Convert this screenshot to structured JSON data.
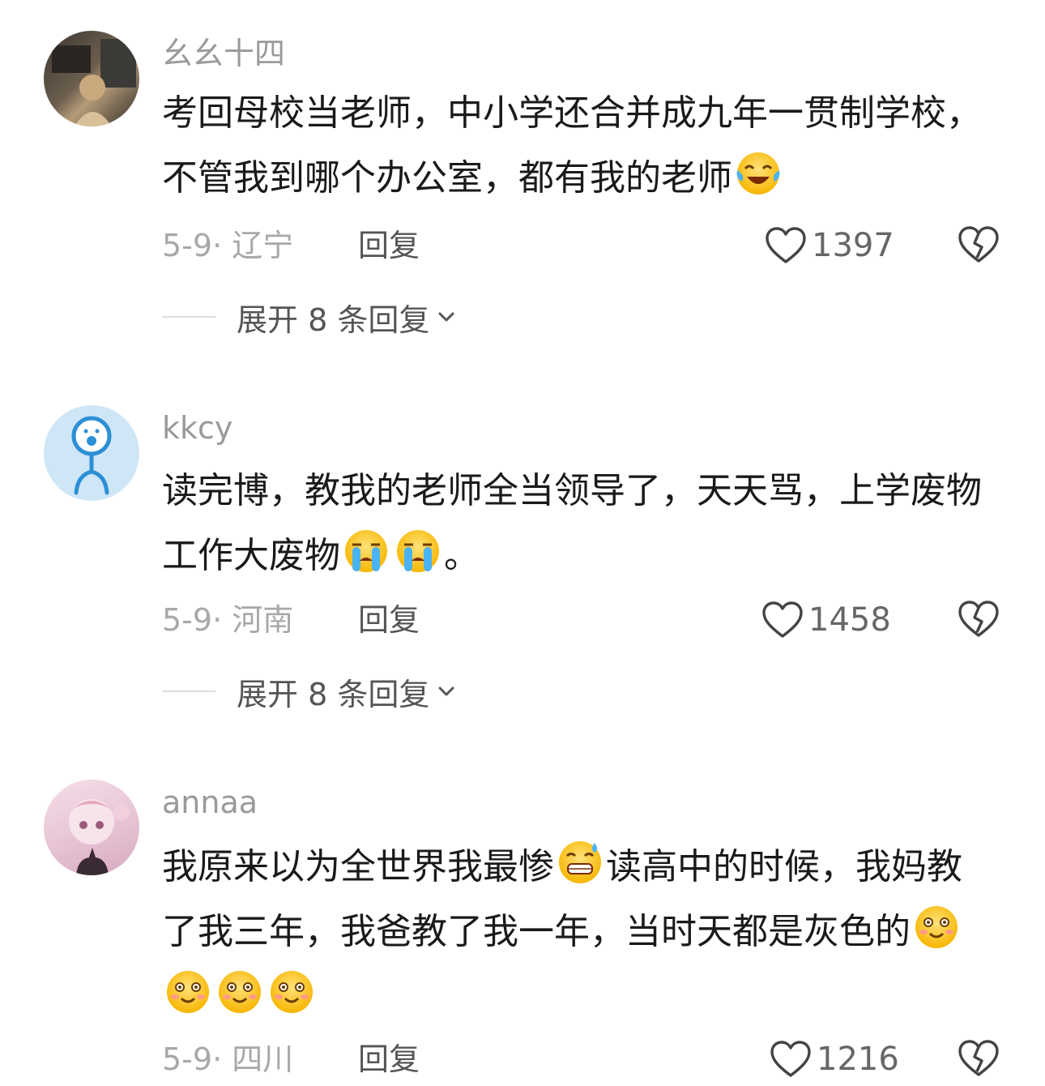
{
  "comments": [
    {
      "username": "幺幺十四",
      "text_a": "考回母校当老师，中小学还合并成九年一贯制学校，不管我到哪个办公室，都有我的老师",
      "text_b": "",
      "meta": "5-9· 辽宁",
      "reply": "回复",
      "likes": "1397",
      "expand": "展开 8 条回复"
    },
    {
      "username": "kkcy",
      "text_a": "读完博，教我的老师全当领导了，天天骂，上学废物工作大废物",
      "text_b": "。",
      "meta": "5-9· 河南",
      "reply": "回复",
      "likes": "1458",
      "expand": "展开 8 条回复"
    },
    {
      "username": "annaa",
      "text_a": "我原来以为全世界我最惨",
      "text_b": "读高中的时候，我妈教了我三年，我爸教了我一年，当时天都是灰色的",
      "meta": "5-9· 四川",
      "reply": "回复",
      "likes": "1216",
      "expand": ""
    }
  ],
  "icons": {
    "like": "heart-outline-icon",
    "dislike": "broken-heart-icon",
    "expand": "chevron-down-icon",
    "emoji_1": "tears-of-joy-emoji",
    "emoji_2": "loudly-crying-emoji",
    "emoji_3": "grimace-sweat-emoji",
    "emoji_4": "smiling-blush-emoji"
  }
}
